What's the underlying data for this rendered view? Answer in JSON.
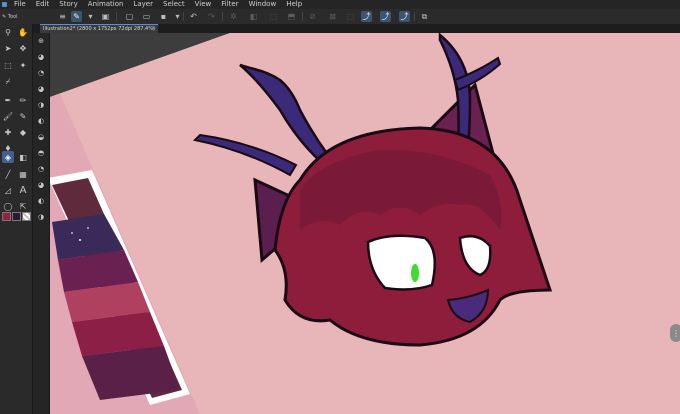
{
  "menu": {
    "items": [
      "File",
      "Edit",
      "Story",
      "Animation",
      "Layer",
      "Select",
      "View",
      "Filter",
      "Window",
      "Help"
    ]
  },
  "toolbar": {
    "header": "Tool",
    "main_color": "#9e1e3f",
    "sub_color": "#2a1c2e"
  },
  "document": {
    "tab_title": "Illustration2* (2800 x 1752px 72dpi 287.4%)",
    "tab_close": "×"
  },
  "icons": {
    "logo": "app-logo",
    "scroll": "scroll-handle-icon"
  },
  "canvas": {
    "background": "#e8b5b8",
    "palette_colors": [
      "#5e2a3c",
      "#3a2a5a",
      "#6a2050",
      "#b04060",
      "#8c1f45",
      "#5a2048",
      "#2e1c3a"
    ],
    "character_skin": "#8e1d3c",
    "antler_color": "#3b2a7a",
    "eye_color": "#3ddc2f"
  }
}
